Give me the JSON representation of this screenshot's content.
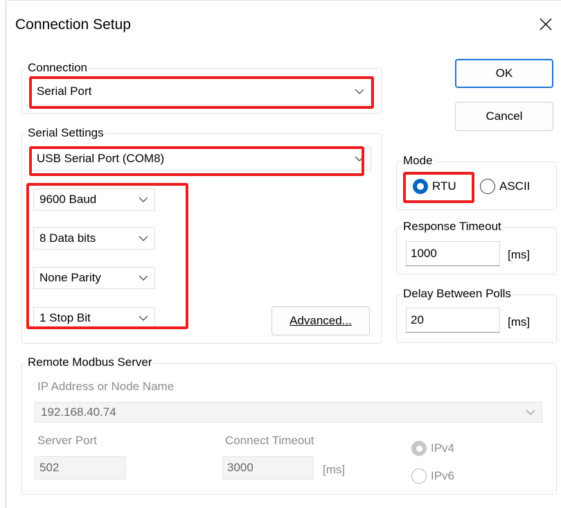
{
  "dialog": {
    "title": "Connection Setup",
    "close_glyph": "✕"
  },
  "buttons": {
    "ok": "OK",
    "cancel": "Cancel",
    "advanced": "Advanced..."
  },
  "connection": {
    "label": "Connection",
    "value": "Serial Port"
  },
  "serial": {
    "label": "Serial Settings",
    "port": "USB Serial Port (COM8)",
    "baud": "9600 Baud",
    "data_bits": "8 Data bits",
    "parity": "None Parity",
    "stop_bits": "1 Stop Bit"
  },
  "mode": {
    "label": "Mode",
    "rtu": "RTU",
    "ascii": "ASCII",
    "selected": "RTU"
  },
  "response_timeout": {
    "label": "Response Timeout",
    "value": "1000",
    "unit": "[ms]"
  },
  "delay_polls": {
    "label": "Delay Between Polls",
    "value": "20",
    "unit": "[ms]"
  },
  "remote": {
    "label": "Remote Modbus Server",
    "ip_label": "IP Address or Node Name",
    "ip_value": "192.168.40.74",
    "port_label": "Server Port",
    "port_value": "502",
    "timeout_label": "Connect Timeout",
    "timeout_value": "3000",
    "timeout_unit": "[ms]",
    "ipv4": "IPv4",
    "ipv6": "IPv6",
    "selected_ip": "IPv4"
  },
  "colors": {
    "accent": "#0067c0",
    "highlight": "#ee1c1c",
    "disabled_text": "#8c8c8c"
  },
  "icons": {
    "close": "close-icon",
    "dropdown": "chevron-down-icon"
  }
}
